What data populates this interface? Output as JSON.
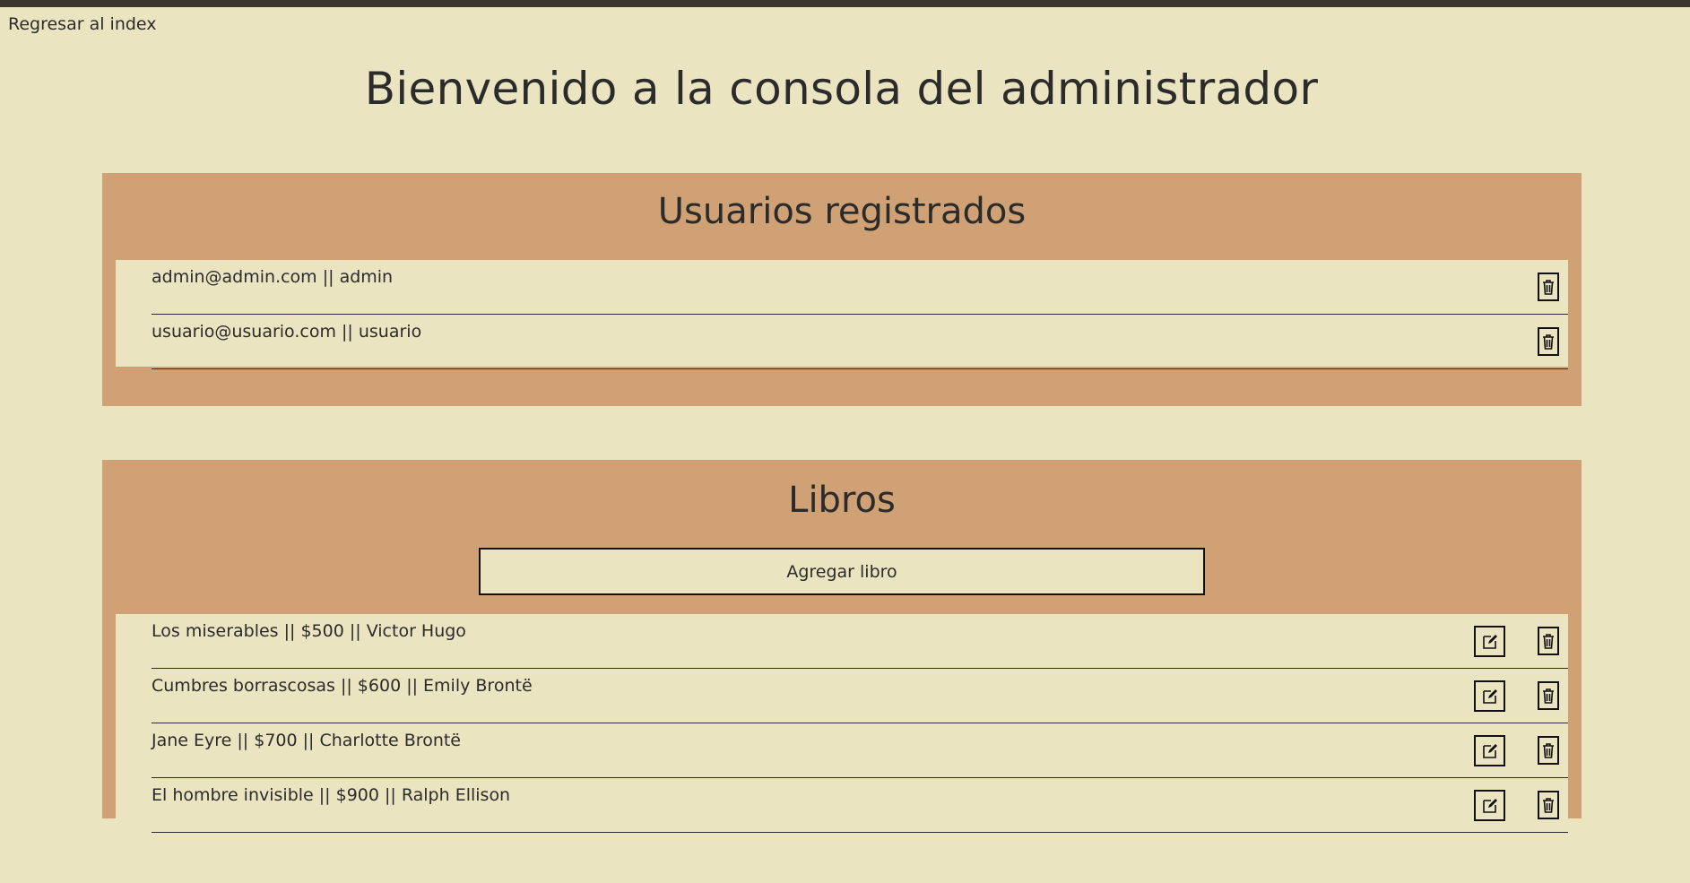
{
  "nav": {
    "back_label": "Regresar al index"
  },
  "page": {
    "title": "Bienvenido a la consola del administrador"
  },
  "users": {
    "title": "Usuarios registrados",
    "rows": [
      {
        "text": "admin@admin.com || admin"
      },
      {
        "text": "usuario@usuario.com || usuario"
      }
    ]
  },
  "books": {
    "title": "Libros",
    "add_label": "Agregar libro",
    "rows": [
      {
        "text": "Los miserables || $500 || Victor Hugo"
      },
      {
        "text": "Cumbres borrascosas || $600 || Emily Brontë"
      },
      {
        "text": "Jane Eyre || $700 || Charlotte Brontë"
      },
      {
        "text": "El hombre invisible || $900 || Ralph Ellison"
      }
    ]
  },
  "icons": {
    "delete": "trash-icon",
    "edit": "edit-icon"
  },
  "colors": {
    "background": "#ebe4c1",
    "panel": "#cfa174",
    "topbar": "#3a3731",
    "text": "#2b2b2b"
  }
}
